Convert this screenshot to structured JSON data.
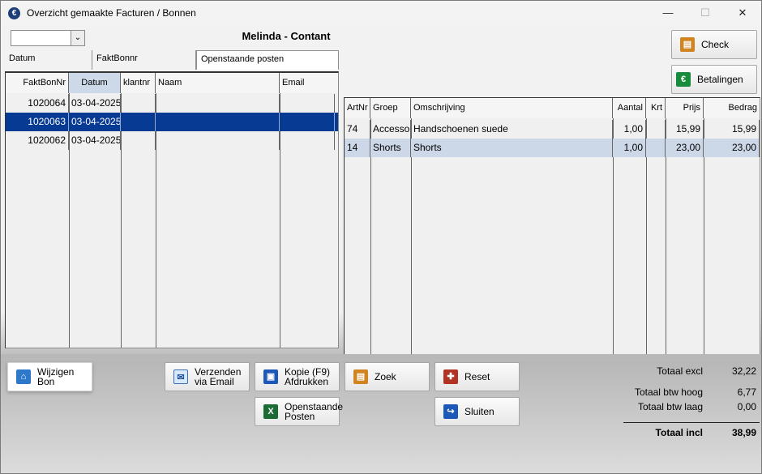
{
  "window": {
    "title": "Overzicht gemaakte Facturen / Bonnen",
    "minimize": "—",
    "maximize": "☐",
    "close": "✕"
  },
  "filter": {
    "selected_value": "",
    "dropdown_icon": "chevron-down-icon"
  },
  "customer": {
    "name": "Melinda",
    "separator": "-",
    "payment_type": "Contant"
  },
  "tabs": [
    {
      "label": "Datum",
      "active": false
    },
    {
      "label": "FaktBonnr",
      "active": false
    },
    {
      "label": "Openstaande posten",
      "active": true
    }
  ],
  "left_grid": {
    "headers": [
      "FaktBonNr",
      "Datum",
      "klantnr",
      "Naam",
      "Email"
    ],
    "rows": [
      [
        "1020064",
        "03-04-2025",
        "",
        "",
        ""
      ],
      [
        "1020063",
        "03-04-2025",
        "",
        "",
        ""
      ],
      [
        "1020062",
        "03-04-2025",
        "",
        "",
        ""
      ]
    ],
    "selected_row": 1
  },
  "right_grid": {
    "headers": [
      "ArtNr",
      "Groep",
      "Omschrijving",
      "Aantal",
      "Krt",
      "Prijs",
      "Bedrag"
    ],
    "rows": [
      [
        "74",
        "Accessoire",
        "Handschoenen suede",
        "1,00",
        "",
        "15,99",
        "15,99"
      ],
      [
        "14",
        "Shorts",
        "Shorts",
        "1,00",
        "",
        "23,00",
        "23,00"
      ]
    ],
    "selected_row": 1
  },
  "buttons": {
    "check": "Check",
    "betalingen": "Betalingen",
    "wijzigen_bon": "Wijzigen\nBon",
    "verzenden": "Verzenden\nvia Email",
    "kopie": "Kopie (F9)\nAfdrukken",
    "zoek": "Zoek",
    "reset": "Reset",
    "openstaande_posten": "Openstaande\nPosten",
    "sluiten": "Sluiten"
  },
  "totals": {
    "excl_label": "Totaal excl",
    "excl_value": "32,22",
    "btw_hoog_label": "Totaal btw hoog",
    "btw_hoog_value": "6,77",
    "btw_laag_label": "Totaal btw laag",
    "btw_laag_value": "0,00",
    "incl_label": "Totaal incl",
    "incl_value": "38,99"
  },
  "colors": {
    "selected_row": "#063a93",
    "selected_detail_row": "#ccd8e7",
    "button_orange": "#d08422",
    "button_green": "#188b3d",
    "button_blue": "#1c58b8"
  }
}
